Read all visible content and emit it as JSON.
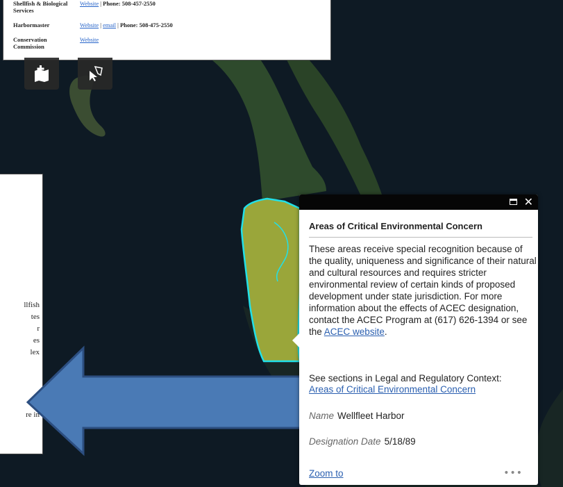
{
  "contacts": [
    {
      "label": "Shellfish & Biological Services",
      "links": [
        "Website"
      ],
      "phone": "Phone: 508-457-2550"
    },
    {
      "label": "Harbormaster",
      "links": [
        "Website",
        "email"
      ],
      "phone": "Phone: 508-475-2550"
    },
    {
      "label": "Conservation Commission",
      "links": [
        "Website"
      ],
      "phone": ""
    }
  ],
  "doc_fragment_lines": [
    "llfish",
    "tes",
    "r",
    "es",
    "lex",
    "",
    "",
    "re in"
  ],
  "popup": {
    "title": "Areas of Critical Environmental Concern",
    "description": "These areas receive special recognition because of the quality, uniqueness and significance of their natural and cultural resources and requires stricter environmental review of certain kinds of proposed development under state jurisdiction. For more information about the effects of ACEC designation, contact the ACEC Program at (617) 626-1394 or see the",
    "description_link": "ACEC website",
    "description_end": ".",
    "section_text": "See sections in Legal and Regulatory Context:",
    "section_link": "Areas of Critical Environmental Concern",
    "name_label": "Name",
    "name_value": "Wellfleet Harbor",
    "date_label": "Designation Date",
    "date_value": "5/18/89",
    "zoom_label": "Zoom to",
    "more_label": "•••",
    "close_label": "✕"
  },
  "colors": {
    "water": "#0e1a24",
    "land": "#2c4a2a",
    "acec_fill": "#9aa63a",
    "acec_outline": "#22e0e8",
    "arrow_fill": "#4a7ab5",
    "arrow_stroke": "#2c4e80",
    "link": "#2a5fb0"
  },
  "icons": {
    "add_layer": "map-plus-icon",
    "select_tool": "select-cursor-icon",
    "maximize": "maximize-icon",
    "close": "close-icon",
    "more": "ellipsis-icon"
  }
}
